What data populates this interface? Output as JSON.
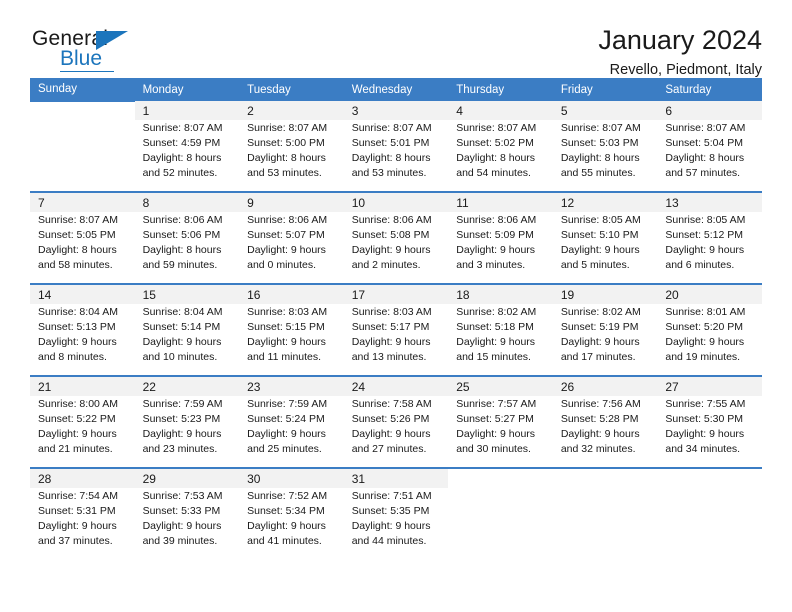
{
  "brand": {
    "name_top": "General",
    "name_bottom": "Blue",
    "accent_color": "#1c75bc",
    "triangle_icon": "brand-triangle-icon"
  },
  "header": {
    "title": "January 2024",
    "subtitle": "Revello, Piedmont, Italy"
  },
  "calendar": {
    "header_bg": "#3b7dc4",
    "daynum_bg": "#f2f2f2",
    "weekday_headers": [
      "Sunday",
      "Monday",
      "Tuesday",
      "Wednesday",
      "Thursday",
      "Friday",
      "Saturday"
    ],
    "weeks": [
      [
        {
          "day": "",
          "lines": []
        },
        {
          "day": "1",
          "lines": [
            "Sunrise: 8:07 AM",
            "Sunset: 4:59 PM",
            "Daylight: 8 hours",
            "and 52 minutes."
          ]
        },
        {
          "day": "2",
          "lines": [
            "Sunrise: 8:07 AM",
            "Sunset: 5:00 PM",
            "Daylight: 8 hours",
            "and 53 minutes."
          ]
        },
        {
          "day": "3",
          "lines": [
            "Sunrise: 8:07 AM",
            "Sunset: 5:01 PM",
            "Daylight: 8 hours",
            "and 53 minutes."
          ]
        },
        {
          "day": "4",
          "lines": [
            "Sunrise: 8:07 AM",
            "Sunset: 5:02 PM",
            "Daylight: 8 hours",
            "and 54 minutes."
          ]
        },
        {
          "day": "5",
          "lines": [
            "Sunrise: 8:07 AM",
            "Sunset: 5:03 PM",
            "Daylight: 8 hours",
            "and 55 minutes."
          ]
        },
        {
          "day": "6",
          "lines": [
            "Sunrise: 8:07 AM",
            "Sunset: 5:04 PM",
            "Daylight: 8 hours",
            "and 57 minutes."
          ]
        }
      ],
      [
        {
          "day": "7",
          "lines": [
            "Sunrise: 8:07 AM",
            "Sunset: 5:05 PM",
            "Daylight: 8 hours",
            "and 58 minutes."
          ]
        },
        {
          "day": "8",
          "lines": [
            "Sunrise: 8:06 AM",
            "Sunset: 5:06 PM",
            "Daylight: 8 hours",
            "and 59 minutes."
          ]
        },
        {
          "day": "9",
          "lines": [
            "Sunrise: 8:06 AM",
            "Sunset: 5:07 PM",
            "Daylight: 9 hours",
            "and 0 minutes."
          ]
        },
        {
          "day": "10",
          "lines": [
            "Sunrise: 8:06 AM",
            "Sunset: 5:08 PM",
            "Daylight: 9 hours",
            "and 2 minutes."
          ]
        },
        {
          "day": "11",
          "lines": [
            "Sunrise: 8:06 AM",
            "Sunset: 5:09 PM",
            "Daylight: 9 hours",
            "and 3 minutes."
          ]
        },
        {
          "day": "12",
          "lines": [
            "Sunrise: 8:05 AM",
            "Sunset: 5:10 PM",
            "Daylight: 9 hours",
            "and 5 minutes."
          ]
        },
        {
          "day": "13",
          "lines": [
            "Sunrise: 8:05 AM",
            "Sunset: 5:12 PM",
            "Daylight: 9 hours",
            "and 6 minutes."
          ]
        }
      ],
      [
        {
          "day": "14",
          "lines": [
            "Sunrise: 8:04 AM",
            "Sunset: 5:13 PM",
            "Daylight: 9 hours",
            "and 8 minutes."
          ]
        },
        {
          "day": "15",
          "lines": [
            "Sunrise: 8:04 AM",
            "Sunset: 5:14 PM",
            "Daylight: 9 hours",
            "and 10 minutes."
          ]
        },
        {
          "day": "16",
          "lines": [
            "Sunrise: 8:03 AM",
            "Sunset: 5:15 PM",
            "Daylight: 9 hours",
            "and 11 minutes."
          ]
        },
        {
          "day": "17",
          "lines": [
            "Sunrise: 8:03 AM",
            "Sunset: 5:17 PM",
            "Daylight: 9 hours",
            "and 13 minutes."
          ]
        },
        {
          "day": "18",
          "lines": [
            "Sunrise: 8:02 AM",
            "Sunset: 5:18 PM",
            "Daylight: 9 hours",
            "and 15 minutes."
          ]
        },
        {
          "day": "19",
          "lines": [
            "Sunrise: 8:02 AM",
            "Sunset: 5:19 PM",
            "Daylight: 9 hours",
            "and 17 minutes."
          ]
        },
        {
          "day": "20",
          "lines": [
            "Sunrise: 8:01 AM",
            "Sunset: 5:20 PM",
            "Daylight: 9 hours",
            "and 19 minutes."
          ]
        }
      ],
      [
        {
          "day": "21",
          "lines": [
            "Sunrise: 8:00 AM",
            "Sunset: 5:22 PM",
            "Daylight: 9 hours",
            "and 21 minutes."
          ]
        },
        {
          "day": "22",
          "lines": [
            "Sunrise: 7:59 AM",
            "Sunset: 5:23 PM",
            "Daylight: 9 hours",
            "and 23 minutes."
          ]
        },
        {
          "day": "23",
          "lines": [
            "Sunrise: 7:59 AM",
            "Sunset: 5:24 PM",
            "Daylight: 9 hours",
            "and 25 minutes."
          ]
        },
        {
          "day": "24",
          "lines": [
            "Sunrise: 7:58 AM",
            "Sunset: 5:26 PM",
            "Daylight: 9 hours",
            "and 27 minutes."
          ]
        },
        {
          "day": "25",
          "lines": [
            "Sunrise: 7:57 AM",
            "Sunset: 5:27 PM",
            "Daylight: 9 hours",
            "and 30 minutes."
          ]
        },
        {
          "day": "26",
          "lines": [
            "Sunrise: 7:56 AM",
            "Sunset: 5:28 PM",
            "Daylight: 9 hours",
            "and 32 minutes."
          ]
        },
        {
          "day": "27",
          "lines": [
            "Sunrise: 7:55 AM",
            "Sunset: 5:30 PM",
            "Daylight: 9 hours",
            "and 34 minutes."
          ]
        }
      ],
      [
        {
          "day": "28",
          "lines": [
            "Sunrise: 7:54 AM",
            "Sunset: 5:31 PM",
            "Daylight: 9 hours",
            "and 37 minutes."
          ]
        },
        {
          "day": "29",
          "lines": [
            "Sunrise: 7:53 AM",
            "Sunset: 5:33 PM",
            "Daylight: 9 hours",
            "and 39 minutes."
          ]
        },
        {
          "day": "30",
          "lines": [
            "Sunrise: 7:52 AM",
            "Sunset: 5:34 PM",
            "Daylight: 9 hours",
            "and 41 minutes."
          ]
        },
        {
          "day": "31",
          "lines": [
            "Sunrise: 7:51 AM",
            "Sunset: 5:35 PM",
            "Daylight: 9 hours",
            "and 44 minutes."
          ]
        },
        {
          "day": "",
          "lines": []
        },
        {
          "day": "",
          "lines": []
        },
        {
          "day": "",
          "lines": []
        }
      ]
    ]
  }
}
